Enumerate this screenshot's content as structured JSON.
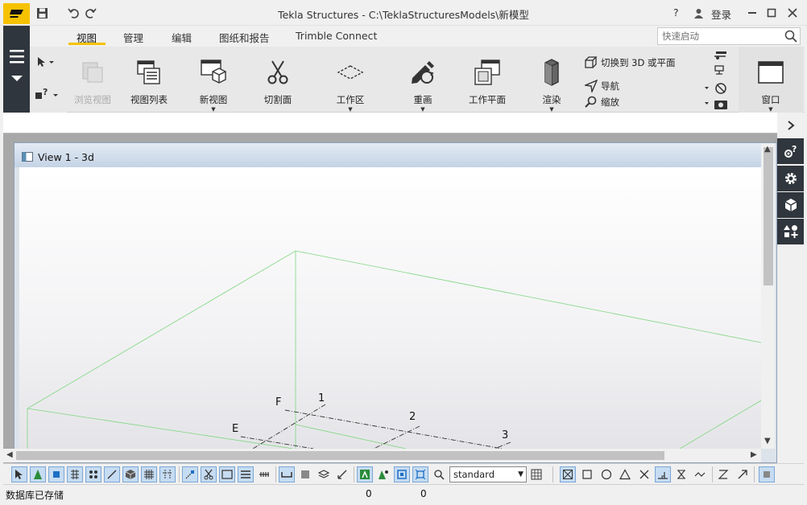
{
  "window": {
    "title": "Tekla Structures - C:\\TeklaStructuresModels\\新模型",
    "help": "?",
    "login": "登录"
  },
  "ribbon": {
    "tabs": [
      {
        "label": "视图",
        "active": true
      },
      {
        "label": "管理"
      },
      {
        "label": "编辑"
      },
      {
        "label": "图纸和报告"
      },
      {
        "label": "Trimble Connect"
      }
    ],
    "quick_launch_placeholder": "快速启动",
    "buttons": {
      "browse_view": "浏览视图",
      "view_list": "视图列表",
      "new_view": "新视图",
      "clip_plane": "切割面",
      "work_area": "工作区",
      "redraw": "重画",
      "work_plane": "工作平面",
      "render": "渲染",
      "switch_3d": "切换到 3D 或平面",
      "navigate": "导航",
      "zoom": "缩放",
      "window": "窗口"
    }
  },
  "view": {
    "title": "View 1 - 3d",
    "grid_labels": [
      "F",
      "E",
      "1",
      "2",
      "3"
    ]
  },
  "bottom_toolbar": {
    "selection_filter": "standard"
  },
  "status": {
    "message": "数据库已存储",
    "value1": "0",
    "value2": "0"
  },
  "colors": {
    "accent": "#f6c200",
    "dark_strip": "#30363d",
    "view_header": "#c4d3e5",
    "work_area_line": "#7fd67f"
  }
}
